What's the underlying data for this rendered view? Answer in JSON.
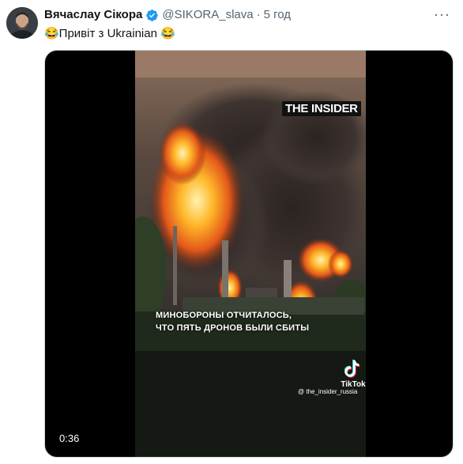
{
  "tweet": {
    "author_name": "Вячаслау Сікора",
    "handle": "@SIKORA_slava",
    "separator": "·",
    "time": "5 год",
    "text": "😂Привіт з Ukrainian 😂",
    "more_label": "···"
  },
  "video": {
    "watermark": "THE INSIDER",
    "caption_line1": "МИНОБОРОНЫ ОТЧИТАЛОСЬ,",
    "caption_line2": "ЧТО ПЯТЬ ДРОНОВ  БЫЛИ СБИТЫ",
    "tiktok_label": "TikTok",
    "tiktok_handle": "@ the_insider_russia",
    "duration": "0:36"
  },
  "colors": {
    "verified": "#1d9bf0",
    "text_primary": "#0f1419",
    "text_secondary": "#536471"
  },
  "icons": {
    "verified": "verified-badge-icon",
    "more": "more-options-icon",
    "tiktok": "tiktok-logo-icon"
  }
}
